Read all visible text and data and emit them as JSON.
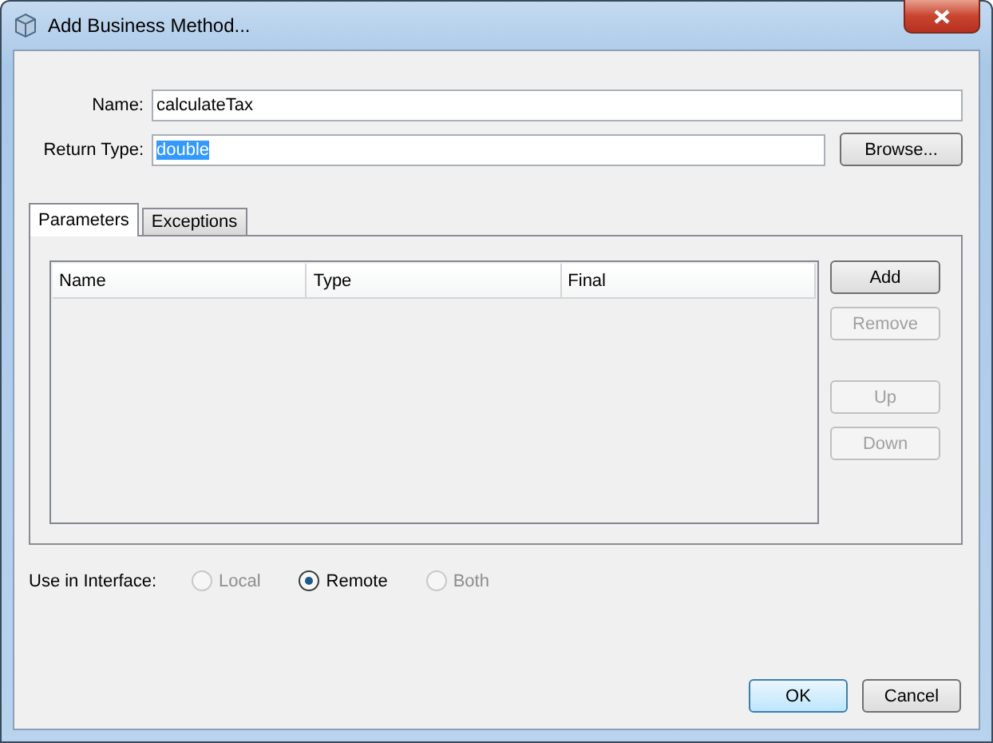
{
  "window": {
    "title": "Add Business Method..."
  },
  "fields": [
    {
      "label": "Name:",
      "value": "calculateTax",
      "highlighted": false
    },
    {
      "label": "Return Type:",
      "value": "double",
      "highlighted": true
    }
  ],
  "browse_button": "Browse...",
  "tabs": [
    {
      "label": "Parameters",
      "selected": true
    },
    {
      "label": "Exceptions",
      "selected": false
    }
  ],
  "table": {
    "columns": [
      "Name",
      "Type",
      "Final"
    ]
  },
  "side_buttons": [
    {
      "label": "Add",
      "disabled": false
    },
    {
      "label": "Remove",
      "disabled": true
    },
    {
      "label": "Up",
      "disabled": true
    },
    {
      "label": "Down",
      "disabled": true
    }
  ],
  "interface": {
    "label": "Use in Interface:",
    "options": [
      {
        "label": "Local",
        "selected": false,
        "disabled": true
      },
      {
        "label": "Remote",
        "selected": true,
        "disabled": false
      },
      {
        "label": "Both",
        "selected": false,
        "disabled": true
      }
    ]
  },
  "buttons": [
    {
      "label": "OK",
      "default": true
    },
    {
      "label": "Cancel",
      "default": false
    }
  ]
}
